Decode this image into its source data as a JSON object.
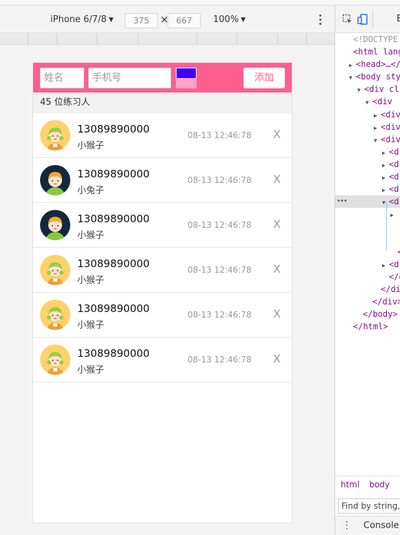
{
  "device_toolbar": {
    "device_name": "iPhone 6/7/8",
    "width": "375",
    "height": "667",
    "dim_separator": "×",
    "zoom": "100%"
  },
  "app": {
    "header": {
      "name_placeholder": "姓名",
      "phone_placeholder": "手机号",
      "color_top": "#3d00ff",
      "color_bottom": "#ffa3c8",
      "add_label": "添加"
    },
    "count_text": "45 位练习人",
    "accent": "#fd5f90",
    "rows": [
      {
        "phone": "13089890000",
        "name": "小猴子",
        "time": "08-13 12:46:78",
        "avatar": "girl-green-icon",
        "del": "X"
      },
      {
        "phone": "13089890000",
        "name": "小兔子",
        "time": "08-13 12:46:78",
        "avatar": "boy-dark-icon",
        "del": "X"
      },
      {
        "phone": "13089890000",
        "name": "小猴子",
        "time": "08-13 12:46:78",
        "avatar": "boy-dark-icon",
        "del": "X"
      },
      {
        "phone": "13089890000",
        "name": "小猴子",
        "time": "08-13 12:46:78",
        "avatar": "girl-green-icon",
        "del": "X"
      },
      {
        "phone": "13089890000",
        "name": "小猴子",
        "time": "08-13 12:46:78",
        "avatar": "girl-green-icon",
        "del": "X"
      },
      {
        "phone": "13089890000",
        "name": "小猴子",
        "time": "08-13 12:46:78",
        "avatar": "girl-green-icon",
        "del": "X"
      }
    ]
  },
  "devtools": {
    "tab": "E",
    "lines": [
      {
        "text": "<!DOCTYPE",
        "gray": true,
        "tri": ""
      },
      {
        "text": "<html lang",
        "tri": ""
      },
      {
        "text": "<head>…</",
        "tri": "▶"
      },
      {
        "text": "<body sty",
        "tri": "▼"
      },
      {
        "text": "<div cl",
        "tri": "▼"
      },
      {
        "text": "<div",
        "tri": "▼"
      },
      {
        "text": "<div",
        "tri": "▶"
      },
      {
        "text": "<div",
        "tri": "▶"
      },
      {
        "text": "<div",
        "tri": "▼"
      },
      {
        "text": "<d",
        "tri": "▶"
      },
      {
        "text": "<d",
        "tri": "▶"
      },
      {
        "text": "<d",
        "tri": "▶"
      },
      {
        "text": "<d",
        "tri": "▶"
      },
      {
        "text": "<d",
        "tri": "▼",
        "selected": true
      },
      {
        "text": "",
        "tri": "▶"
      },
      {
        "text": "",
        "tri": ""
      },
      {
        "text": "",
        "tri": ""
      },
      {
        "text": "</",
        "tri": ""
      },
      {
        "text": "<d",
        "tri": "▶"
      },
      {
        "text": "</di",
        "tri": ""
      },
      {
        "text": "</div",
        "tri": ""
      },
      {
        "text": "</div>",
        "tri": ""
      },
      {
        "text": "</body>",
        "tri": ""
      },
      {
        "text": "</html>",
        "tri": ""
      }
    ],
    "selected_marker": "•••",
    "breadcrumbs": [
      "html",
      "body"
    ],
    "find_placeholder": "Find by string,",
    "console_label": "Console"
  }
}
